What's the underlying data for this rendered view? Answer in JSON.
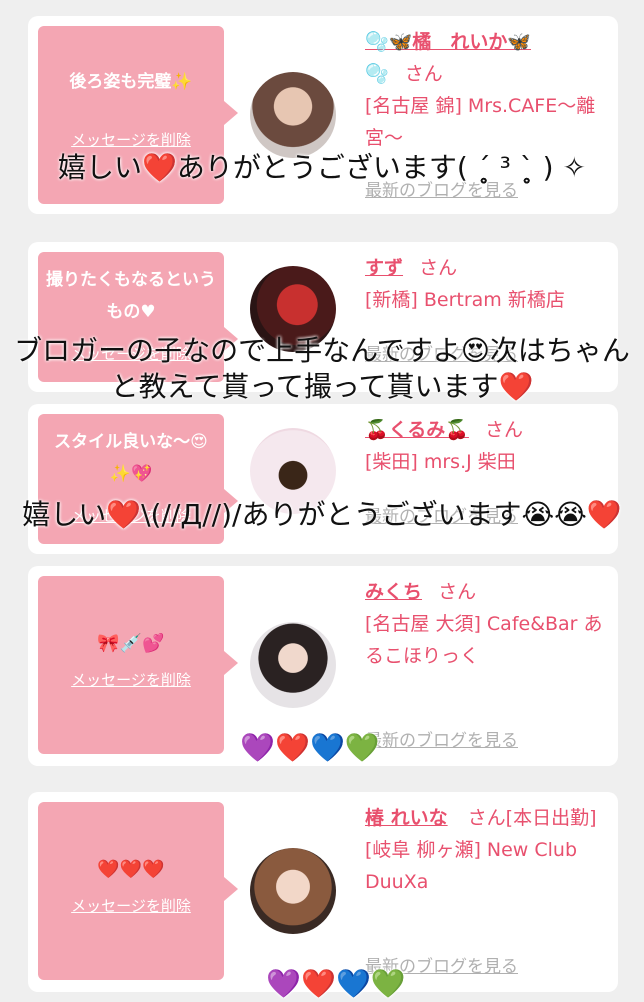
{
  "cards": [
    {
      "message": "後ろ姿も完璧✨",
      "delete_label": "メッセージを削除",
      "name": "🫧🦋橘　れいか🦋",
      "name_line2": "🫧",
      "san": "さん",
      "shop": "[名古屋 錦] Mrs.CAFE〜離宮〜",
      "blog_link": "最新のブログを見る"
    },
    {
      "message": "撮りたくもなるというもの♥",
      "delete_label": "メッセージを削除",
      "name": "すず",
      "san": "さん",
      "shop": "[新橋] Bertram 新橋店",
      "blog_link": "最新のブログを見る"
    },
    {
      "message": "スタイル良いな〜😍✨💖",
      "delete_label": "メッセージを削除",
      "name": "🍒くるみ🍒",
      "san": "さん",
      "shop": "[柴田] mrs.J 柴田",
      "blog_link": "最新のブログを見る"
    },
    {
      "message": "🎀💉💕",
      "delete_label": "メッセージを削除",
      "name": "みくち",
      "san": "さん",
      "shop": "[名古屋 大須] Cafe&Bar あるこほりっく",
      "blog_link": "最新のブログを見る"
    },
    {
      "message": "❤️❤️❤️",
      "delete_label": "メッセージを削除",
      "name": "椿 れいな",
      "san": "さん[本日出勤]",
      "shop": "[岐阜 柳ヶ瀬] New Club DuuXa",
      "blog_link": "最新のブログを見る"
    }
  ],
  "overlays": {
    "reply1": "嬉しい❤️ありがとうございます( ˊ̥̥̥̥̥ ³ ˋ̥̥̥̥̥ ) ✧",
    "reply2": "ブロガーの子なので上手なんですよ😍次はちゃんと教えて貰って撮って貰います❤️",
    "reply3": "嬉しい❤️\\(//Д//)/ありがとうございます😭😭❤️",
    "hearts1": "💜❤️💙💚",
    "hearts2": "💜❤️💙💚"
  }
}
